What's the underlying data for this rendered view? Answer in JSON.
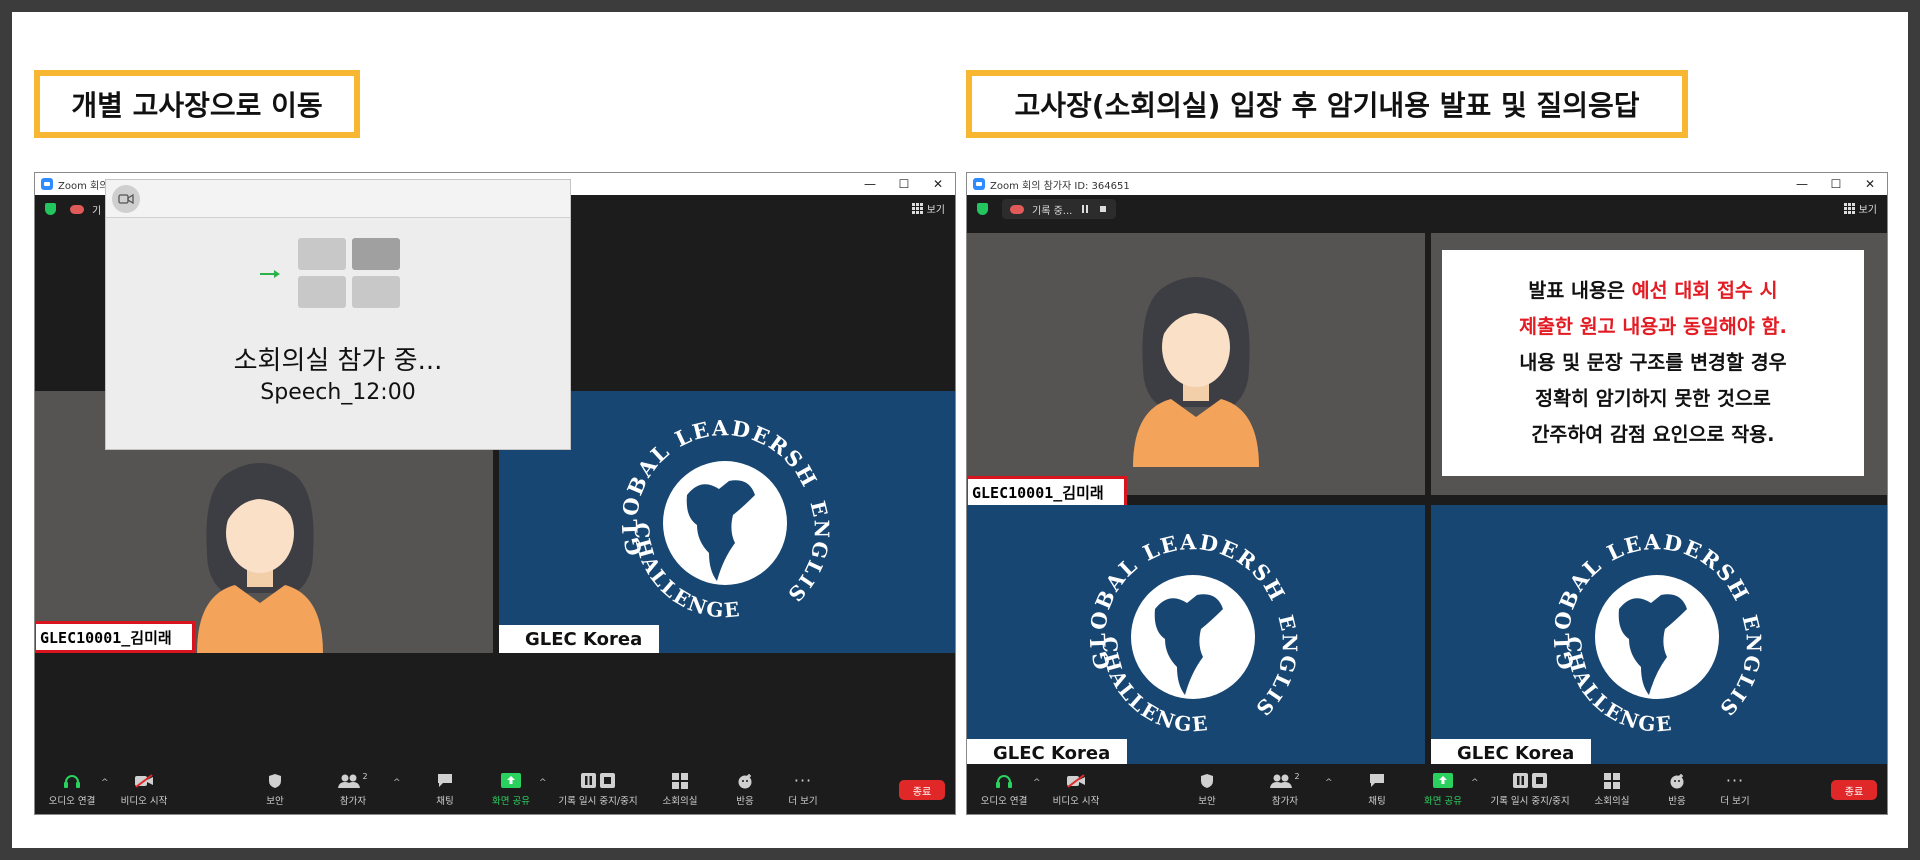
{
  "labels": {
    "left": "개별 고사장으로 이동",
    "right": "고사장(소회의실) 입장 후 암기내용 발표 및 질의응답"
  },
  "left_window": {
    "title": "Zoom 회의",
    "topbar_text": "기",
    "popup": {
      "title": "소회의실 참가 중...",
      "subtitle": "Speech_12:00",
      "icon": "camera-icon"
    },
    "participants": [
      {
        "name": "GLEC10001_김미래"
      },
      {
        "name": "GLEC Korea"
      }
    ]
  },
  "right_window": {
    "title": "Zoom 회의 참가자 ID: 364651",
    "recording_label": "기록 중...",
    "participants": [
      {
        "name": "GLEC10001_김미래"
      },
      {
        "name": "GLEC Korea"
      },
      {
        "name": "GLEC Korea"
      }
    ],
    "message": {
      "line1a": "발표 내용은 ",
      "line1b": "예선 대회 접수 시",
      "line2": "제출한 원고 내용과 동일해야 함.",
      "line3": "내용 및 문장 구조를 변경할 경우",
      "line4": "정확히 암기하지 못한 것으로",
      "line5": "간주하여 감점 요인으로 작용."
    }
  },
  "window_controls": {
    "minimize": "—",
    "maximize": "☐",
    "close": "✕"
  },
  "view_label": "보기",
  "toolbar": {
    "audio": "오디오 연결",
    "video": "비디오 시작",
    "security": "보안",
    "participants": "참가자",
    "participants_count": "2",
    "chat": "채팅",
    "share": "화면 공유",
    "record": "기록 일시 중지/중지",
    "breakout": "소회의실",
    "reactions": "반응",
    "more": "더 보기",
    "end": "종료"
  },
  "logo": {
    "top": "GLOBAL LEADERSHIP",
    "right": "ENGLISH",
    "bottom": "CHALLENGE"
  },
  "colors": {
    "accent_yellow": "#f7b733",
    "zoom_blue": "#2d8cff",
    "glec_navy": "#174672",
    "name_red": "#d8141f",
    "end_red": "#e02828",
    "share_green": "#2bd15f"
  }
}
